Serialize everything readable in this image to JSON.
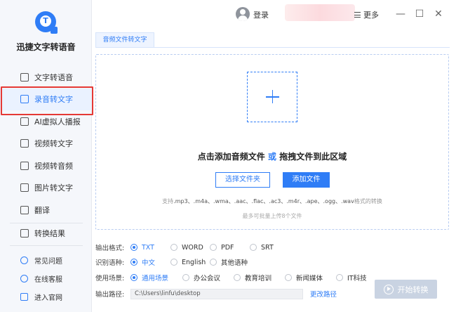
{
  "app": {
    "name": "迅捷文字转语音",
    "logo_letter": "T"
  },
  "sidebar": {
    "items": [
      {
        "label": "文字转语音",
        "icon": "text-to-speech-icon"
      },
      {
        "label": "录音转文字",
        "icon": "audio-to-text-icon",
        "active": true
      },
      {
        "label": "AI虚拟人播报",
        "icon": "ai-avatar-icon"
      },
      {
        "label": "视频转文字",
        "icon": "video-to-text-icon"
      },
      {
        "label": "视频转音频",
        "icon": "video-to-audio-icon"
      },
      {
        "label": "图片转文字",
        "icon": "image-to-text-icon"
      },
      {
        "label": "翻译",
        "icon": "translate-icon"
      }
    ],
    "results_label": "转换结果",
    "bottom_links": [
      {
        "label": "常见问题",
        "icon": "help-icon"
      },
      {
        "label": "在线客服",
        "icon": "headset-icon"
      },
      {
        "label": "进入官网",
        "icon": "monitor-icon"
      }
    ]
  },
  "topbar": {
    "login": "登录",
    "more": "更多",
    "minimize": "—",
    "maximize": "☐",
    "close": "✕"
  },
  "tab": {
    "label": "音频文件转文字"
  },
  "dropzone": {
    "title_part1": "点击添加音频文件",
    "title_or": "或",
    "title_part2": "拖拽文件到此区域",
    "select_folder": "选择文件夹",
    "add_file": "添加文件",
    "formats_prefix": "支持",
    "formats": ".mp3、.m4a、.wma、.aac、.flac、.ac3、.m4r、.ape、.ogg、.wav",
    "formats_suffix": "格式的转换",
    "limit": "最多可批量上传8个文件"
  },
  "options": {
    "output_format": {
      "label": "输出格式:",
      "choices": [
        "TXT",
        "WORD",
        "PDF",
        "SRT"
      ],
      "selected": "TXT"
    },
    "language": {
      "label": "识别语种:",
      "choices": [
        "中文",
        "English",
        "其他语种"
      ],
      "selected": "中文"
    },
    "scene": {
      "label": "使用场景:",
      "choices": [
        "通用场景",
        "办公会议",
        "教育培训",
        "新闻媒体",
        "IT科技"
      ],
      "selected": "通用场景"
    },
    "output_path": {
      "label": "输出路径:",
      "value": "C:\\Users\\linfu\\desktop",
      "change": "更改路径"
    }
  },
  "start_button": "开始转换",
  "colors": {
    "accent": "#2f7df6",
    "highlight_border": "#e53935",
    "start_disabled": "#c9d3e2"
  }
}
